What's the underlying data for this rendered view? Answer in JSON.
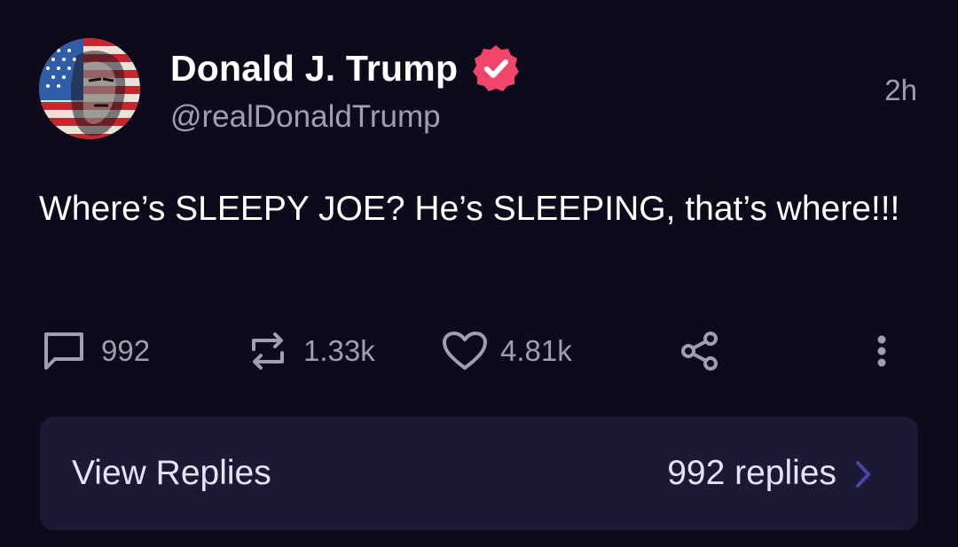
{
  "post": {
    "author": {
      "display_name": "Donald J. Trump",
      "handle": "@realDonaldTrump",
      "verified": true,
      "avatar_icon": "flag-portrait-avatar"
    },
    "timestamp": "2h",
    "text": "Where’s SLEEPY JOE? He’s SLEEPING, that’s where!!!",
    "actions": {
      "replies": "992",
      "reposts": "1.33k",
      "likes": "4.81k",
      "share_icon": "share-icon",
      "more_icon": "more-vertical-icon"
    },
    "replies_card": {
      "label": "View Replies",
      "count_text": "992 replies"
    }
  },
  "colors": {
    "background": "#0d0a1c",
    "muted_text": "#a19eb0",
    "card_background": "#1c1935",
    "verified_badge": "#f0466a",
    "chevron": "#4a44a8"
  }
}
